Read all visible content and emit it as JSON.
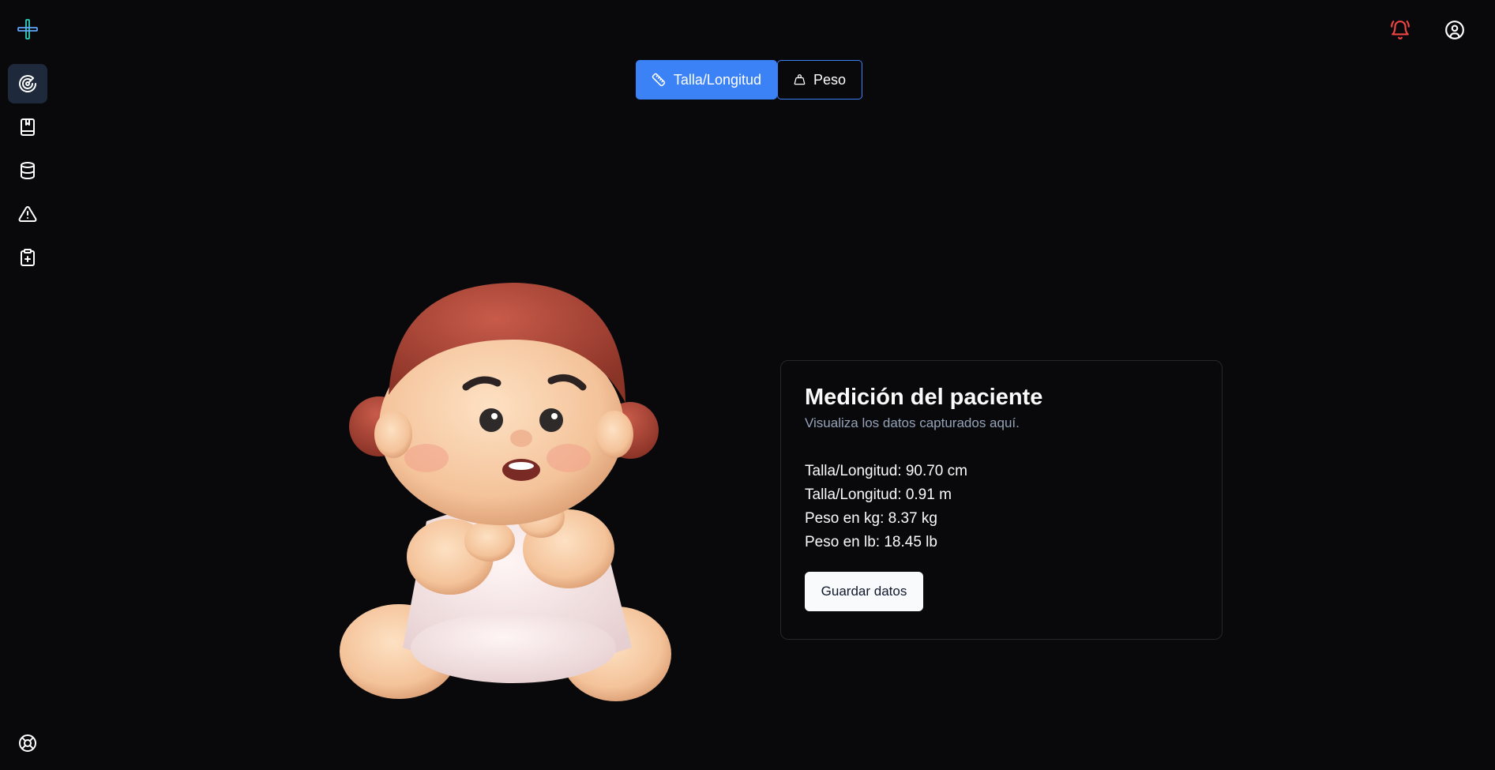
{
  "sidebar": {
    "logo_icon": "medical-plus-icon",
    "items": [
      {
        "name": "radar",
        "icon": "radar-icon",
        "active": true
      },
      {
        "name": "book",
        "icon": "bookmark-book-icon",
        "active": false
      },
      {
        "name": "database",
        "icon": "database-icon",
        "active": false
      },
      {
        "name": "alerts",
        "icon": "warning-triangle-icon",
        "active": false
      },
      {
        "name": "clipboard",
        "icon": "clipboard-plus-icon",
        "active": false
      }
    ],
    "help_icon": "life-buoy-icon"
  },
  "header": {
    "notification_icon": "bell-alert-icon",
    "notification_color": "#ef4444",
    "account_icon": "user-circle-icon"
  },
  "toggle": {
    "length_label": "Talla/Longitud",
    "weight_label": "Peso",
    "active": "length"
  },
  "card": {
    "title": "Medición del paciente",
    "subtitle": "Visualiza los datos capturados aquí.",
    "rows": [
      "Talla/Longitud: 90.70 cm",
      "Talla/Longitud: 0.91 m",
      "Peso en kg: 8.37 kg",
      "Peso en lb: 18.45 lb"
    ],
    "save_label": "Guardar datos"
  },
  "colors": {
    "background": "#09090b",
    "accent": "#3b82f6",
    "logo": "#2dd4bf"
  }
}
